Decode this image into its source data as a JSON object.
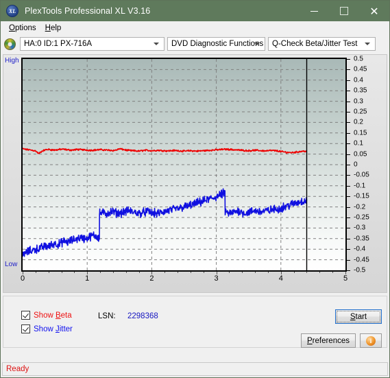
{
  "window": {
    "title": "PlexTools Professional XL V3.16",
    "icon": "xl-disc-icon",
    "minimize": "minimize-icon",
    "maximize": "maximize-icon",
    "close": "close-icon"
  },
  "menubar": {
    "items": [
      {
        "label": "Options",
        "accel": "O"
      },
      {
        "label": "Help",
        "accel": "H"
      }
    ]
  },
  "toolbar": {
    "drive_icon": "cd-disc-icon",
    "drive_combo": {
      "value": "HA:0 ID:1  PX-716A",
      "caret": "chevron-down-icon"
    },
    "function_combo": {
      "value": "DVD Diagnostic Functions",
      "caret": "chevron-down-icon"
    },
    "test_combo": {
      "value": "Q-Check Beta/Jitter Test",
      "caret": "chevron-down-icon"
    }
  },
  "chart_panel": {
    "high_label": "High",
    "low_label": "Low"
  },
  "controls": {
    "show_beta": {
      "label_pre": "Show ",
      "label_accel": "B",
      "label_post": "eta",
      "checked": true,
      "color": "#ee1111"
    },
    "show_jitter": {
      "label_pre": "Show ",
      "label_accel": "J",
      "label_post": "itter",
      "checked": true,
      "color": "#1111ee"
    },
    "lsn_label": "LSN:",
    "lsn_value": "2298368",
    "start_button": {
      "pre": "",
      "accel": "S",
      "post": "tart"
    },
    "preferences_button": {
      "pre": "",
      "accel": "P",
      "post": "references"
    },
    "info_button": {
      "glyph": "i"
    }
  },
  "statusbar": {
    "text": "Ready"
  },
  "chart_data": {
    "type": "line",
    "title": "Q-Check Beta/Jitter Test",
    "xlabel": "",
    "ylabel": "",
    "xlim": [
      0,
      5
    ],
    "ylim": [
      -0.5,
      0.5
    ],
    "xticks": [
      0,
      1,
      2,
      3,
      4,
      5
    ],
    "yticks": [
      0.5,
      0.45,
      0.4,
      0.35,
      0.3,
      0.25,
      0.2,
      0.15,
      0.1,
      0.05,
      0,
      -0.05,
      -0.1,
      -0.15,
      -0.2,
      -0.25,
      -0.3,
      -0.35,
      -0.4,
      -0.45,
      -0.5
    ],
    "grid": true,
    "grid_style": "dashed",
    "grid_color": "#808080",
    "background_gradient": [
      "#a9b9b7",
      "#ffffff"
    ],
    "data_end_marker_x": 4.4,
    "legend": [
      "Show Beta",
      "Show Jitter"
    ],
    "series": [
      {
        "name": "Beta",
        "color": "#ee0000",
        "comment": "Beta trace, roughly flat just above 0.05 across whole disc",
        "x": [
          0.0,
          0.05,
          0.1,
          0.15,
          0.2,
          0.25,
          0.3,
          0.35,
          0.4,
          0.45,
          0.5,
          0.55,
          0.6,
          0.65,
          0.7,
          0.75,
          0.8,
          0.85,
          0.9,
          0.95,
          1.0,
          1.05,
          1.1,
          1.15,
          1.2,
          1.25,
          1.3,
          1.35,
          1.4,
          1.45,
          1.5,
          1.55,
          1.6,
          1.65,
          1.7,
          1.75,
          1.8,
          1.85,
          1.9,
          1.95,
          2.0,
          2.05,
          2.1,
          2.15,
          2.2,
          2.25,
          2.3,
          2.35,
          2.4,
          2.45,
          2.5,
          2.55,
          2.6,
          2.65,
          2.7,
          2.75,
          2.8,
          2.85,
          2.9,
          2.95,
          3.0,
          3.05,
          3.1,
          3.15,
          3.2,
          3.25,
          3.3,
          3.35,
          3.4,
          3.45,
          3.5,
          3.55,
          3.6,
          3.65,
          3.7,
          3.75,
          3.8,
          3.85,
          3.9,
          3.95,
          4.0,
          4.05,
          4.1,
          4.15,
          4.2,
          4.25,
          4.3,
          4.35,
          4.4
        ],
        "y": [
          0.075,
          0.072,
          0.07,
          0.068,
          0.065,
          0.052,
          0.064,
          0.07,
          0.072,
          0.07,
          0.069,
          0.071,
          0.073,
          0.072,
          0.07,
          0.069,
          0.07,
          0.072,
          0.071,
          0.07,
          0.069,
          0.068,
          0.069,
          0.07,
          0.071,
          0.07,
          0.069,
          0.068,
          0.067,
          0.069,
          0.075,
          0.072,
          0.069,
          0.067,
          0.066,
          0.065,
          0.064,
          0.066,
          0.068,
          0.067,
          0.066,
          0.067,
          0.068,
          0.067,
          0.066,
          0.065,
          0.066,
          0.067,
          0.066,
          0.065,
          0.064,
          0.065,
          0.066,
          0.065,
          0.064,
          0.065,
          0.066,
          0.067,
          0.068,
          0.069,
          0.07,
          0.071,
          0.072,
          0.073,
          0.072,
          0.071,
          0.07,
          0.069,
          0.068,
          0.067,
          0.066,
          0.067,
          0.068,
          0.067,
          0.066,
          0.065,
          0.066,
          0.067,
          0.066,
          0.065,
          0.062,
          0.06,
          0.058,
          0.057,
          0.058,
          0.06,
          0.062,
          0.064,
          0.063
        ]
      },
      {
        "name": "Jitter",
        "color": "#1010e0",
        "comment": "Jitter trace (plotted inverted/negative scale); steps up at ~1.19, peak ~3.1, drops back",
        "x": [
          0.0,
          0.05,
          0.1,
          0.15,
          0.2,
          0.25,
          0.3,
          0.35,
          0.4,
          0.45,
          0.5,
          0.55,
          0.6,
          0.65,
          0.7,
          0.75,
          0.8,
          0.85,
          0.9,
          0.95,
          1.0,
          1.05,
          1.1,
          1.15,
          1.18,
          1.2,
          1.25,
          1.3,
          1.35,
          1.4,
          1.45,
          1.5,
          1.55,
          1.6,
          1.65,
          1.7,
          1.75,
          1.8,
          1.85,
          1.9,
          1.95,
          2.0,
          2.05,
          2.1,
          2.15,
          2.2,
          2.25,
          2.3,
          2.35,
          2.4,
          2.45,
          2.5,
          2.55,
          2.6,
          2.65,
          2.7,
          2.75,
          2.8,
          2.85,
          2.9,
          2.95,
          3.0,
          3.05,
          3.1,
          3.12,
          3.15,
          3.2,
          3.25,
          3.3,
          3.35,
          3.4,
          3.45,
          3.5,
          3.55,
          3.6,
          3.65,
          3.7,
          3.75,
          3.8,
          3.85,
          3.9,
          3.95,
          4.0,
          4.05,
          4.1,
          4.15,
          4.2,
          4.25,
          4.3,
          4.35,
          4.4
        ],
        "y": [
          -0.435,
          -0.415,
          -0.41,
          -0.405,
          -0.4,
          -0.398,
          -0.392,
          -0.385,
          -0.388,
          -0.38,
          -0.372,
          -0.378,
          -0.37,
          -0.362,
          -0.368,
          -0.36,
          -0.355,
          -0.35,
          -0.345,
          -0.35,
          -0.348,
          -0.34,
          -0.335,
          -0.34,
          -0.345,
          -0.23,
          -0.228,
          -0.232,
          -0.225,
          -0.222,
          -0.228,
          -0.23,
          -0.226,
          -0.222,
          -0.218,
          -0.224,
          -0.226,
          -0.23,
          -0.228,
          -0.224,
          -0.222,
          -0.228,
          -0.23,
          -0.232,
          -0.226,
          -0.222,
          -0.218,
          -0.214,
          -0.212,
          -0.208,
          -0.205,
          -0.2,
          -0.198,
          -0.192,
          -0.188,
          -0.182,
          -0.178,
          -0.172,
          -0.168,
          -0.162,
          -0.158,
          -0.152,
          -0.145,
          -0.138,
          -0.132,
          -0.225,
          -0.232,
          -0.228,
          -0.222,
          -0.218,
          -0.226,
          -0.23,
          -0.226,
          -0.222,
          -0.218,
          -0.22,
          -0.222,
          -0.22,
          -0.218,
          -0.215,
          -0.212,
          -0.21,
          -0.205,
          -0.2,
          -0.195,
          -0.19,
          -0.185,
          -0.18,
          -0.175,
          -0.172,
          -0.17
        ]
      }
    ]
  }
}
